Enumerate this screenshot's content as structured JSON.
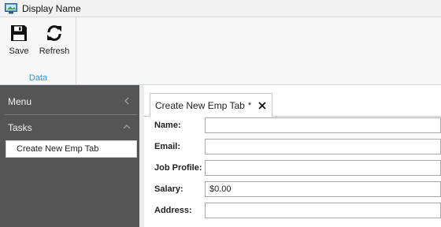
{
  "window": {
    "title": "Display Name"
  },
  "ribbon": {
    "buttons": [
      {
        "label": "Save",
        "icon": "floppy-disk-icon"
      },
      {
        "label": "Refresh",
        "icon": "refresh-icon"
      }
    ],
    "group_label": "Data",
    "accent_color": "#3a8ed6"
  },
  "sidebar": {
    "menu_label": "Menu",
    "tasks_label": "Tasks",
    "items": [
      {
        "label": "Create New Emp Tab"
      }
    ],
    "background_color": "#555555"
  },
  "tab": {
    "label": "Create New Emp Tab",
    "modified_marker": "*"
  },
  "form": {
    "fields": [
      {
        "label": "Name:",
        "value": ""
      },
      {
        "label": "Email:",
        "value": ""
      },
      {
        "label": "Job Profile:",
        "value": ""
      },
      {
        "label": "Salary:",
        "value": "$0.00"
      },
      {
        "label": "Address:",
        "value": ""
      }
    ]
  }
}
